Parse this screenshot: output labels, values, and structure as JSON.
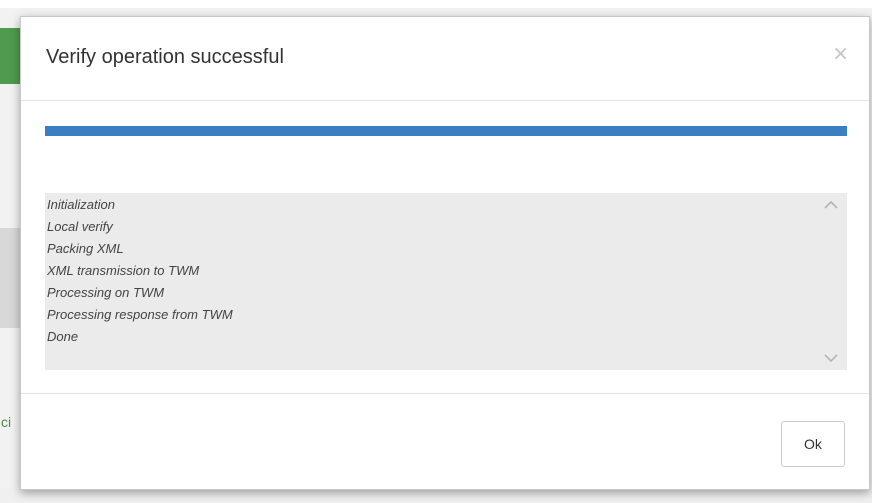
{
  "dialog": {
    "title": "Verify operation successful",
    "close_symbol": "×",
    "close_icon": "close-icon",
    "progress_percent": 100,
    "progress_color": "#3a7fc1",
    "log": [
      "Initialization",
      "Local verify",
      "Packing XML",
      "XML transmission to TWM",
      "Processing on TWM",
      "Processing response from TWM",
      "Done"
    ],
    "scroll_up_icon": "chevron-up-icon",
    "scroll_down_icon": "chevron-down-icon",
    "ok_label": "Ok"
  },
  "background": {
    "partial_text": "ci",
    "accent_color": "#4f9a4f"
  }
}
